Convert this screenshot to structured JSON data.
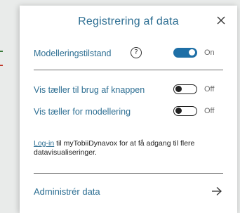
{
  "dialog": {
    "title": "Registrering af data",
    "close_icon": "close-icon"
  },
  "modelling_mode": {
    "label": "Modelleringstilstand",
    "help_glyph": "?",
    "toggle_on": true,
    "state_text": "On"
  },
  "counter_button": {
    "label": "Vis tæller til brug af knappen",
    "toggle_on": false,
    "state_text": "Off"
  },
  "counter_modelling": {
    "label": "Vis tæller for modellering",
    "toggle_on": false,
    "state_text": "Off"
  },
  "info": {
    "link_text": "Log-in",
    "rest_text": " til myTobiiDynavox for at få adgang til flere datavisualiseringer."
  },
  "manage": {
    "label": "Administrér data",
    "icon": "arrow-right-icon"
  },
  "colors": {
    "accent": "#2e6f93",
    "toggle_on": "#1e6fa6"
  }
}
